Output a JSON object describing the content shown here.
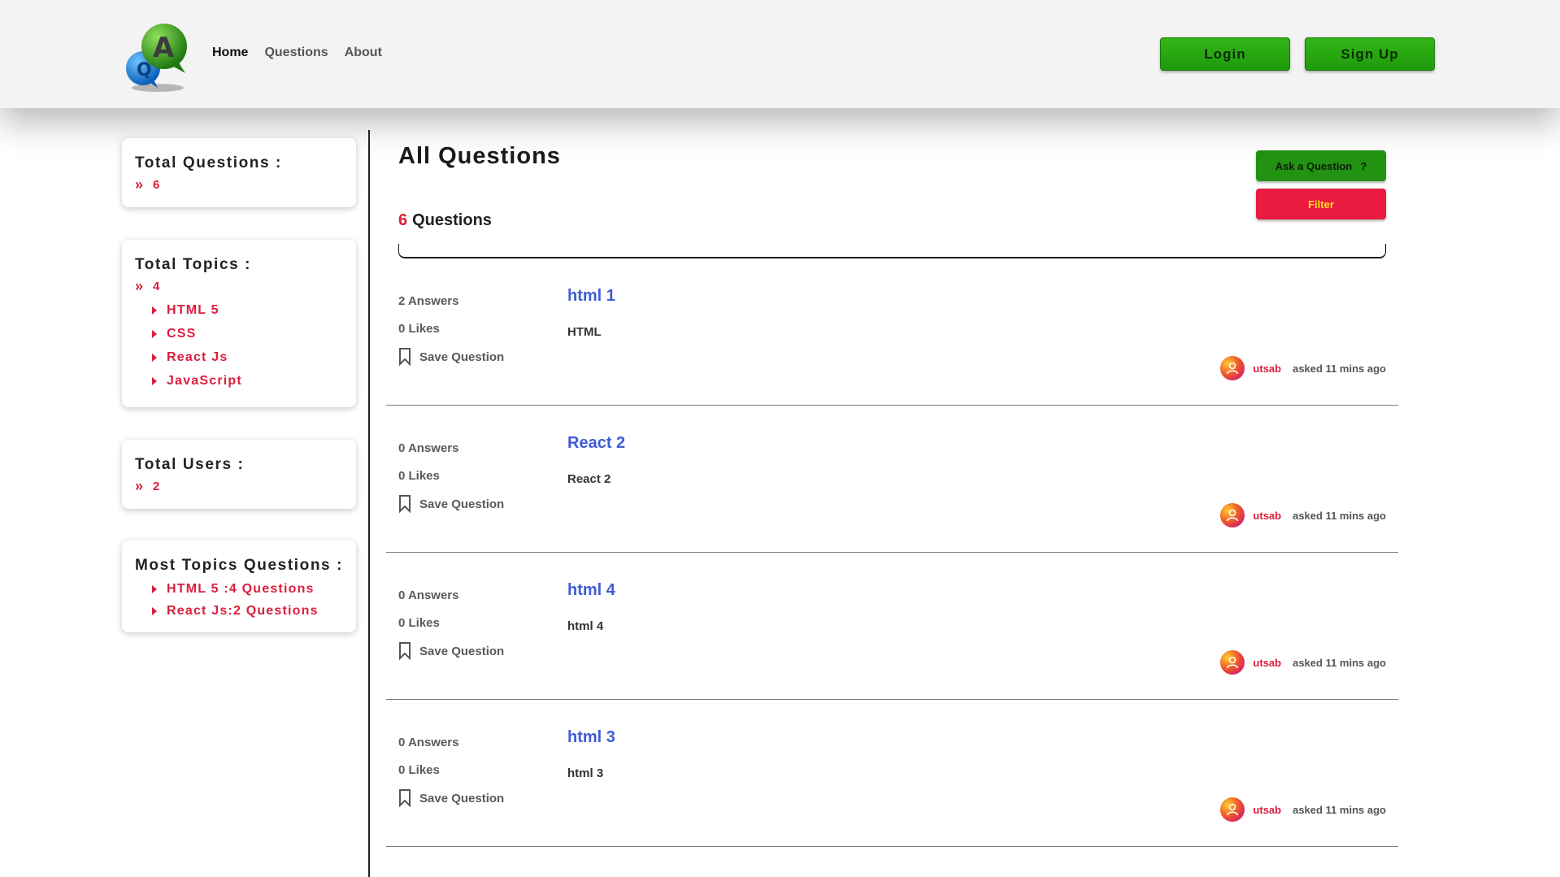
{
  "header": {
    "nav": [
      "Home",
      "Questions",
      "About"
    ],
    "login_label": "Login",
    "signup_label": "Sign Up"
  },
  "sidebar": {
    "total_questions": {
      "title": "Total Questions :",
      "count": "6"
    },
    "total_topics": {
      "title": "Total Topics :",
      "count": "4",
      "items": [
        "HTML 5",
        "CSS",
        "React Js",
        "JavaScript"
      ]
    },
    "total_users": {
      "title": "Total Users :",
      "count": "2"
    },
    "most_topics": {
      "title": "Most Topics Questions :",
      "items": [
        "HTML 5 :4 Questions",
        "React Js:2 Questions"
      ]
    }
  },
  "main": {
    "title": "All Questions",
    "question_count": "6",
    "question_count_label": "Questions",
    "ask_label": "Ask a Question",
    "ask_icon": "?",
    "filter_label": "Filter",
    "save_label": "Save Question",
    "questions": [
      {
        "answers": "2 Answers",
        "likes": "0 Likes",
        "title": "html 1",
        "body": "HTML",
        "user": "utsab",
        "asked": "asked 11 mins ago"
      },
      {
        "answers": "0 Answers",
        "likes": "0 Likes",
        "title": "React 2",
        "body": "React 2",
        "user": "utsab",
        "asked": "asked 11 mins ago"
      },
      {
        "answers": "0 Answers",
        "likes": "0 Likes",
        "title": "html 4",
        "body": "html 4",
        "user": "utsab",
        "asked": "asked 11 mins ago"
      },
      {
        "answers": "0 Answers",
        "likes": "0 Likes",
        "title": "html 3",
        "body": "html 3",
        "user": "utsab",
        "asked": "asked 11 mins ago"
      }
    ]
  },
  "colors": {
    "accent_red": "#dc1d3c",
    "accent_green": "#229213",
    "link_blue": "#3e5cd6",
    "filter_text": "#ffdf20"
  }
}
